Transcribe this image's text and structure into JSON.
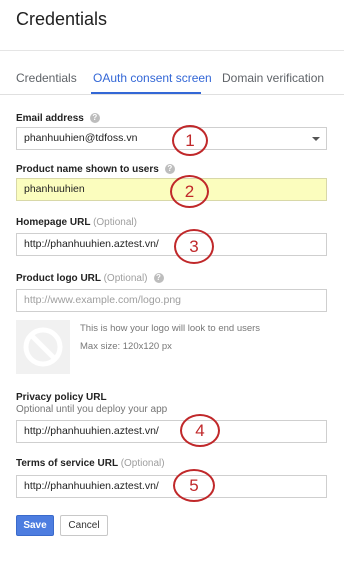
{
  "header": {
    "title": "Credentials"
  },
  "tabs": [
    {
      "label": "Credentials",
      "active": false
    },
    {
      "label": "OAuth consent screen",
      "active": true
    },
    {
      "label": "Domain verification",
      "active": false
    }
  ],
  "form": {
    "email": {
      "label": "Email address",
      "value": "phanhuuhien@tdfoss.vn",
      "help_icon": "question-circle-icon",
      "annotation": "1"
    },
    "product_name": {
      "label": "Product name shown to users",
      "value": "phanhuuhien",
      "help_icon": "question-circle-icon",
      "annotation": "2",
      "background": "#fbfdbe"
    },
    "homepage": {
      "label": "Homepage URL",
      "optional": "(Optional)",
      "value": "http://phanhuuhien.aztest.vn/",
      "annotation": "3"
    },
    "logo": {
      "label": "Product logo URL",
      "optional": "(Optional)",
      "placeholder": "http://www.example.com/logo.png",
      "help_icon": "question-circle-icon",
      "preview_text": "This is how your logo will look to end users",
      "max_size": "Max size: 120x120 px",
      "preview_icon": "no-image-icon"
    },
    "privacy": {
      "label": "Privacy policy URL",
      "sublabel": "Optional until you deploy your app",
      "value": "http://phanhuuhien.aztest.vn/",
      "annotation": "4"
    },
    "tos": {
      "label": "Terms of service URL",
      "optional": "(Optional)",
      "value": "http://phanhuuhien.aztest.vn/",
      "annotation": "5"
    }
  },
  "actions": {
    "save": "Save",
    "cancel": "Cancel"
  },
  "colors": {
    "accent": "#3367d6",
    "annotation": "#c0282a",
    "primary_button": "#4d7de0"
  }
}
